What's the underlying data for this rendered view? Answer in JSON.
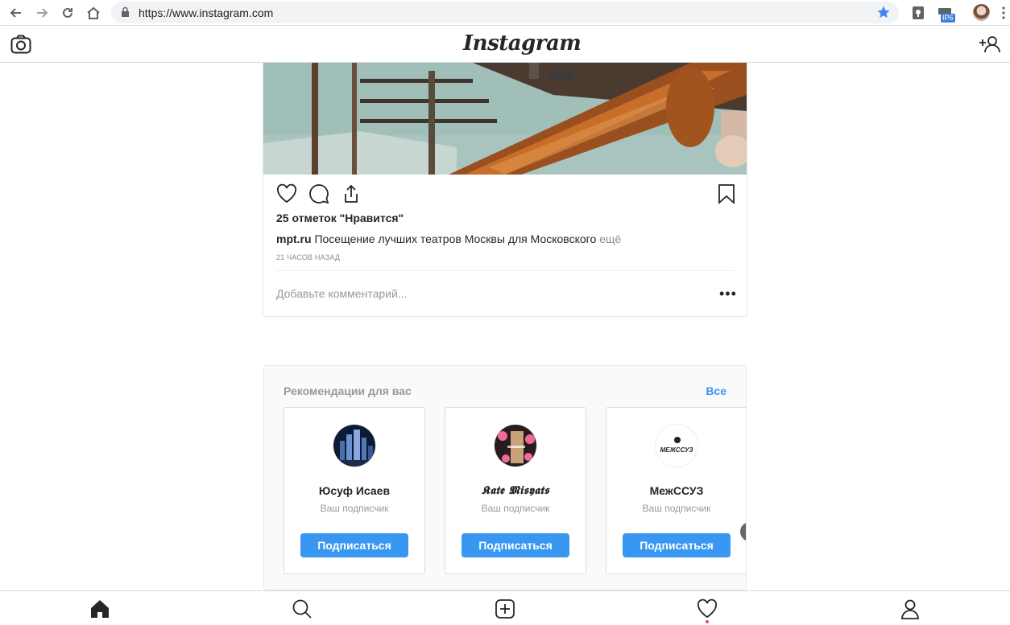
{
  "browser": {
    "url": "https://www.instagram.com",
    "extension_badge": "IP6"
  },
  "header": {
    "logo": "Instagram"
  },
  "post": {
    "likes": "25 отметок \"Нравится\"",
    "author": "mpt.ru",
    "caption": "Посещение лучших театров Москвы для Московского",
    "more": "ещё",
    "time": "21 ЧАСОВ НАЗАД",
    "comment_placeholder": "Добавьте комментарий...",
    "options": "•••"
  },
  "suggestions": {
    "title": "Рекомендации для вас",
    "see_all": "Все",
    "cards": [
      {
        "name": "Юсуф Исаев",
        "subtitle": "Ваш подписчик",
        "button": "Подписаться"
      },
      {
        "name": "𝕶𝖆𝖙𝖊 𝕸𝖎𝖘𝖞𝖆𝖙𝖘",
        "subtitle": "Ваш подписчик",
        "button": "Подписаться"
      },
      {
        "name": "МежССУЗ",
        "subtitle": "Ваш подписчик",
        "button": "Подписаться",
        "avatar_text": "МЕЖССУЗ"
      }
    ]
  },
  "colors": {
    "accent": "#3897f0",
    "notification": "#ed4956"
  }
}
